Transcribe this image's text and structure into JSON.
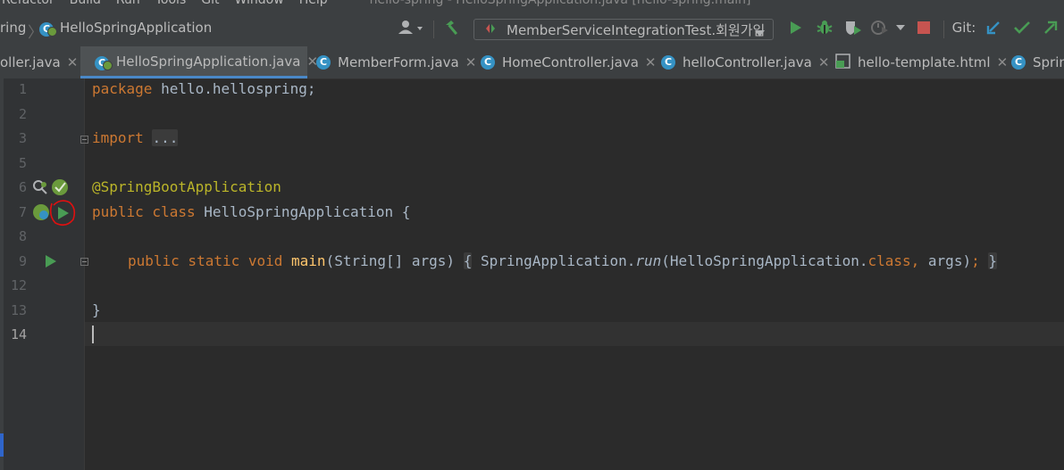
{
  "menu": [
    "Refactor",
    "Build",
    "Run",
    "Tools",
    "Git",
    "Window",
    "Help"
  ],
  "window_title": "hello-spring - HelloSpringApplication.java [hello-spring.main]",
  "breadcrumb": {
    "project": "ring",
    "file": "HelloSpringApplication"
  },
  "toolbar": {
    "run_config": "MemberServiceIntegrationTest.회원가입",
    "git_label": "Git:",
    "colors": {
      "run": "#499c54",
      "stop": "#c75450",
      "git_update": "#3592c4"
    }
  },
  "tabs": [
    {
      "label": "oller.java",
      "active": false
    },
    {
      "label": "HelloSpringApplication.java",
      "active": true
    },
    {
      "label": "MemberForm.java",
      "active": false
    },
    {
      "label": "HomeController.java",
      "active": false
    },
    {
      "label": "helloController.java",
      "active": false
    },
    {
      "label": "hello-template.html",
      "active": false
    },
    {
      "label": "Sprin",
      "active": false
    }
  ],
  "icon_letter": "C",
  "close_glyph": "✕",
  "line_numbers": [
    "1",
    "2",
    "3",
    "5",
    "6",
    "7",
    "8",
    "9",
    "12",
    "13",
    "14"
  ],
  "code": {
    "l1_kw": "package",
    "l1_rest": " hello.hellospring;",
    "l3_kw": "import",
    "l3_fold": "...",
    "l6": "@SpringBootApplication",
    "l7_kw": "public class",
    "l7_rest": " HelloSpringApplication {",
    "l9_kw": "public static void",
    "l9_fn": "main",
    "l9_params": "(String[] args)",
    "l9_open": "{",
    "l9_call": "SpringApplication.",
    "l9_run": "run",
    "l9_args_a": "(HelloSpringApplication.",
    "l9_class": "class",
    "l9_comma": ",",
    "l9_args_b": " args)",
    "l9_semi": ";",
    "l9_close": "}",
    "l13": "}"
  }
}
